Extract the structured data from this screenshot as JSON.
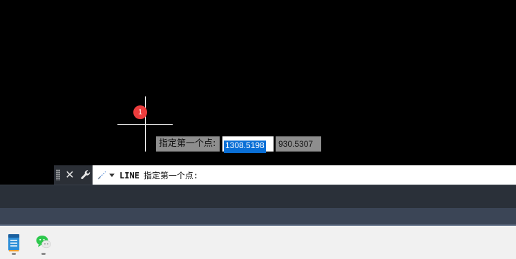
{
  "canvas": {
    "marker_label": "1"
  },
  "dynamic_input": {
    "prompt": "指定第一个点:",
    "x_value": "1308.5198",
    "y_value": "930.5307"
  },
  "command_line": {
    "command": "LINE",
    "prompt": "指定第一个点:",
    "close_icon": "close-icon",
    "settings_icon": "wrench-icon",
    "command_icon": "pen-icon"
  },
  "taskbar": {
    "apps": [
      {
        "icon": "notepad-icon"
      },
      {
        "icon": "wechat-icon"
      }
    ]
  },
  "colors": {
    "selection": "#0a6fd6",
    "marker": "#ec3d3d",
    "wechat": "#2dc84d"
  }
}
